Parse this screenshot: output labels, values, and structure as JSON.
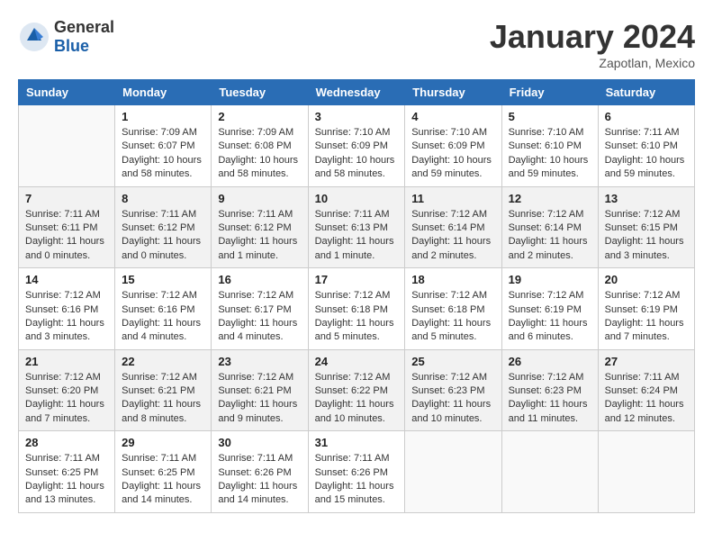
{
  "header": {
    "logo_general": "General",
    "logo_blue": "Blue",
    "month_year": "January 2024",
    "location": "Zapotlan, Mexico"
  },
  "columns": [
    "Sunday",
    "Monday",
    "Tuesday",
    "Wednesday",
    "Thursday",
    "Friday",
    "Saturday"
  ],
  "weeks": [
    [
      {
        "day": "",
        "info": ""
      },
      {
        "day": "1",
        "info": "Sunrise: 7:09 AM\nSunset: 6:07 PM\nDaylight: 10 hours\nand 58 minutes."
      },
      {
        "day": "2",
        "info": "Sunrise: 7:09 AM\nSunset: 6:08 PM\nDaylight: 10 hours\nand 58 minutes."
      },
      {
        "day": "3",
        "info": "Sunrise: 7:10 AM\nSunset: 6:09 PM\nDaylight: 10 hours\nand 58 minutes."
      },
      {
        "day": "4",
        "info": "Sunrise: 7:10 AM\nSunset: 6:09 PM\nDaylight: 10 hours\nand 59 minutes."
      },
      {
        "day": "5",
        "info": "Sunrise: 7:10 AM\nSunset: 6:10 PM\nDaylight: 10 hours\nand 59 minutes."
      },
      {
        "day": "6",
        "info": "Sunrise: 7:11 AM\nSunset: 6:10 PM\nDaylight: 10 hours\nand 59 minutes."
      }
    ],
    [
      {
        "day": "7",
        "info": "Sunrise: 7:11 AM\nSunset: 6:11 PM\nDaylight: 11 hours\nand 0 minutes."
      },
      {
        "day": "8",
        "info": "Sunrise: 7:11 AM\nSunset: 6:12 PM\nDaylight: 11 hours\nand 0 minutes."
      },
      {
        "day": "9",
        "info": "Sunrise: 7:11 AM\nSunset: 6:12 PM\nDaylight: 11 hours\nand 1 minute."
      },
      {
        "day": "10",
        "info": "Sunrise: 7:11 AM\nSunset: 6:13 PM\nDaylight: 11 hours\nand 1 minute."
      },
      {
        "day": "11",
        "info": "Sunrise: 7:12 AM\nSunset: 6:14 PM\nDaylight: 11 hours\nand 2 minutes."
      },
      {
        "day": "12",
        "info": "Sunrise: 7:12 AM\nSunset: 6:14 PM\nDaylight: 11 hours\nand 2 minutes."
      },
      {
        "day": "13",
        "info": "Sunrise: 7:12 AM\nSunset: 6:15 PM\nDaylight: 11 hours\nand 3 minutes."
      }
    ],
    [
      {
        "day": "14",
        "info": "Sunrise: 7:12 AM\nSunset: 6:16 PM\nDaylight: 11 hours\nand 3 minutes."
      },
      {
        "day": "15",
        "info": "Sunrise: 7:12 AM\nSunset: 6:16 PM\nDaylight: 11 hours\nand 4 minutes."
      },
      {
        "day": "16",
        "info": "Sunrise: 7:12 AM\nSunset: 6:17 PM\nDaylight: 11 hours\nand 4 minutes."
      },
      {
        "day": "17",
        "info": "Sunrise: 7:12 AM\nSunset: 6:18 PM\nDaylight: 11 hours\nand 5 minutes."
      },
      {
        "day": "18",
        "info": "Sunrise: 7:12 AM\nSunset: 6:18 PM\nDaylight: 11 hours\nand 5 minutes."
      },
      {
        "day": "19",
        "info": "Sunrise: 7:12 AM\nSunset: 6:19 PM\nDaylight: 11 hours\nand 6 minutes."
      },
      {
        "day": "20",
        "info": "Sunrise: 7:12 AM\nSunset: 6:19 PM\nDaylight: 11 hours\nand 7 minutes."
      }
    ],
    [
      {
        "day": "21",
        "info": "Sunrise: 7:12 AM\nSunset: 6:20 PM\nDaylight: 11 hours\nand 7 minutes."
      },
      {
        "day": "22",
        "info": "Sunrise: 7:12 AM\nSunset: 6:21 PM\nDaylight: 11 hours\nand 8 minutes."
      },
      {
        "day": "23",
        "info": "Sunrise: 7:12 AM\nSunset: 6:21 PM\nDaylight: 11 hours\nand 9 minutes."
      },
      {
        "day": "24",
        "info": "Sunrise: 7:12 AM\nSunset: 6:22 PM\nDaylight: 11 hours\nand 10 minutes."
      },
      {
        "day": "25",
        "info": "Sunrise: 7:12 AM\nSunset: 6:23 PM\nDaylight: 11 hours\nand 10 minutes."
      },
      {
        "day": "26",
        "info": "Sunrise: 7:12 AM\nSunset: 6:23 PM\nDaylight: 11 hours\nand 11 minutes."
      },
      {
        "day": "27",
        "info": "Sunrise: 7:11 AM\nSunset: 6:24 PM\nDaylight: 11 hours\nand 12 minutes."
      }
    ],
    [
      {
        "day": "28",
        "info": "Sunrise: 7:11 AM\nSunset: 6:25 PM\nDaylight: 11 hours\nand 13 minutes."
      },
      {
        "day": "29",
        "info": "Sunrise: 7:11 AM\nSunset: 6:25 PM\nDaylight: 11 hours\nand 14 minutes."
      },
      {
        "day": "30",
        "info": "Sunrise: 7:11 AM\nSunset: 6:26 PM\nDaylight: 11 hours\nand 14 minutes."
      },
      {
        "day": "31",
        "info": "Sunrise: 7:11 AM\nSunset: 6:26 PM\nDaylight: 11 hours\nand 15 minutes."
      },
      {
        "day": "",
        "info": ""
      },
      {
        "day": "",
        "info": ""
      },
      {
        "day": "",
        "info": ""
      }
    ]
  ]
}
